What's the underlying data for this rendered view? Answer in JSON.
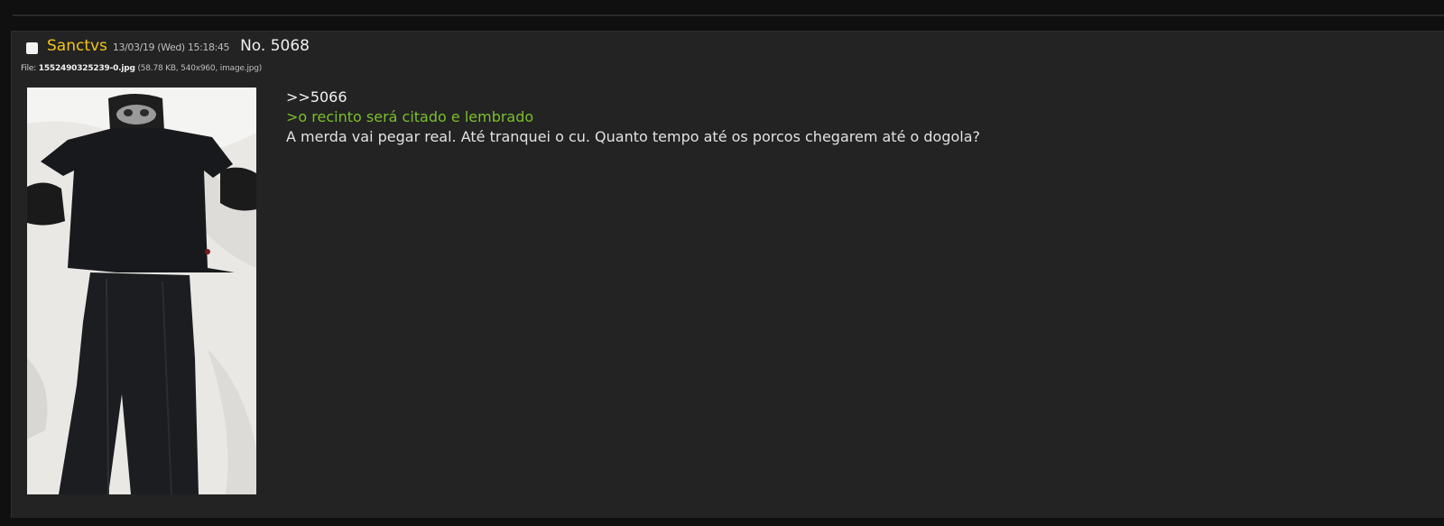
{
  "post": {
    "name": "Sanctvs",
    "date": "13/03/19 (Wed) 15:18:45",
    "number": "No. 5068",
    "file": {
      "label": "File:",
      "name": "1552490325239-0.jpg",
      "meta": "(58.78 KB, 540x960, image.jpg)"
    },
    "body": {
      "quote_link": ">>5066",
      "greentext": ">o recinto será citado e lembrado",
      "text": "A merda vai pegar real. Até tranquei o cu. Quanto tempo até os porcos chegarem até o dogola?"
    }
  },
  "colors": {
    "background": "#101010",
    "post_background": "#232323",
    "name": "#f5c518",
    "greentext": "#7cbf2a"
  }
}
